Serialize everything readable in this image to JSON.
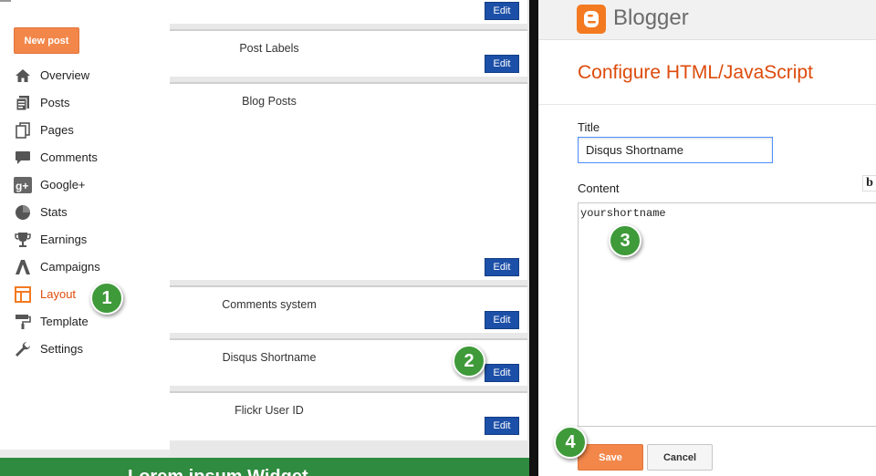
{
  "sidebar": {
    "new_post_label": "New post",
    "accent_color": "#dd4b0c",
    "items": [
      {
        "label": "Overview",
        "icon": "home-icon"
      },
      {
        "label": "Posts",
        "icon": "posts-icon"
      },
      {
        "label": "Pages",
        "icon": "pages-icon"
      },
      {
        "label": "Comments",
        "icon": "comments-icon"
      },
      {
        "label": "Google+",
        "icon": "google-plus-icon"
      },
      {
        "label": "Stats",
        "icon": "stats-pie-icon"
      },
      {
        "label": "Earnings",
        "icon": "trophy-icon"
      },
      {
        "label": "Campaigns",
        "icon": "adwords-icon"
      },
      {
        "label": "Layout",
        "icon": "layout-icon",
        "active": true
      },
      {
        "label": "Template",
        "icon": "paint-roller-icon"
      },
      {
        "label": "Settings",
        "icon": "wrench-icon"
      }
    ]
  },
  "layout": {
    "edit_label": "Edit",
    "gadgets": [
      {
        "title": ""
      },
      {
        "title": "Post Labels"
      },
      {
        "title": "Blog Posts"
      },
      {
        "title": "Comments system"
      },
      {
        "title": "Disqus Shortname"
      },
      {
        "title": "Flickr User ID"
      }
    ],
    "footer_band_text": "Lorem ipsum Widget"
  },
  "dialog": {
    "brand": "Blogger",
    "heading": "Configure HTML/JavaScript",
    "title_label": "Title",
    "title_value": "Disqus Shortname",
    "content_label": "Content",
    "bold_label": "b",
    "content_value": "yourshortname",
    "save_label": "Save",
    "cancel_label": "Cancel"
  },
  "steps": [
    "1",
    "2",
    "3",
    "4"
  ],
  "colors": {
    "step_green": "#3f9a3a",
    "edit_blue": "#1c4fa7",
    "orange_button": "#f3874a",
    "blogger_orange": "#f37a21"
  }
}
